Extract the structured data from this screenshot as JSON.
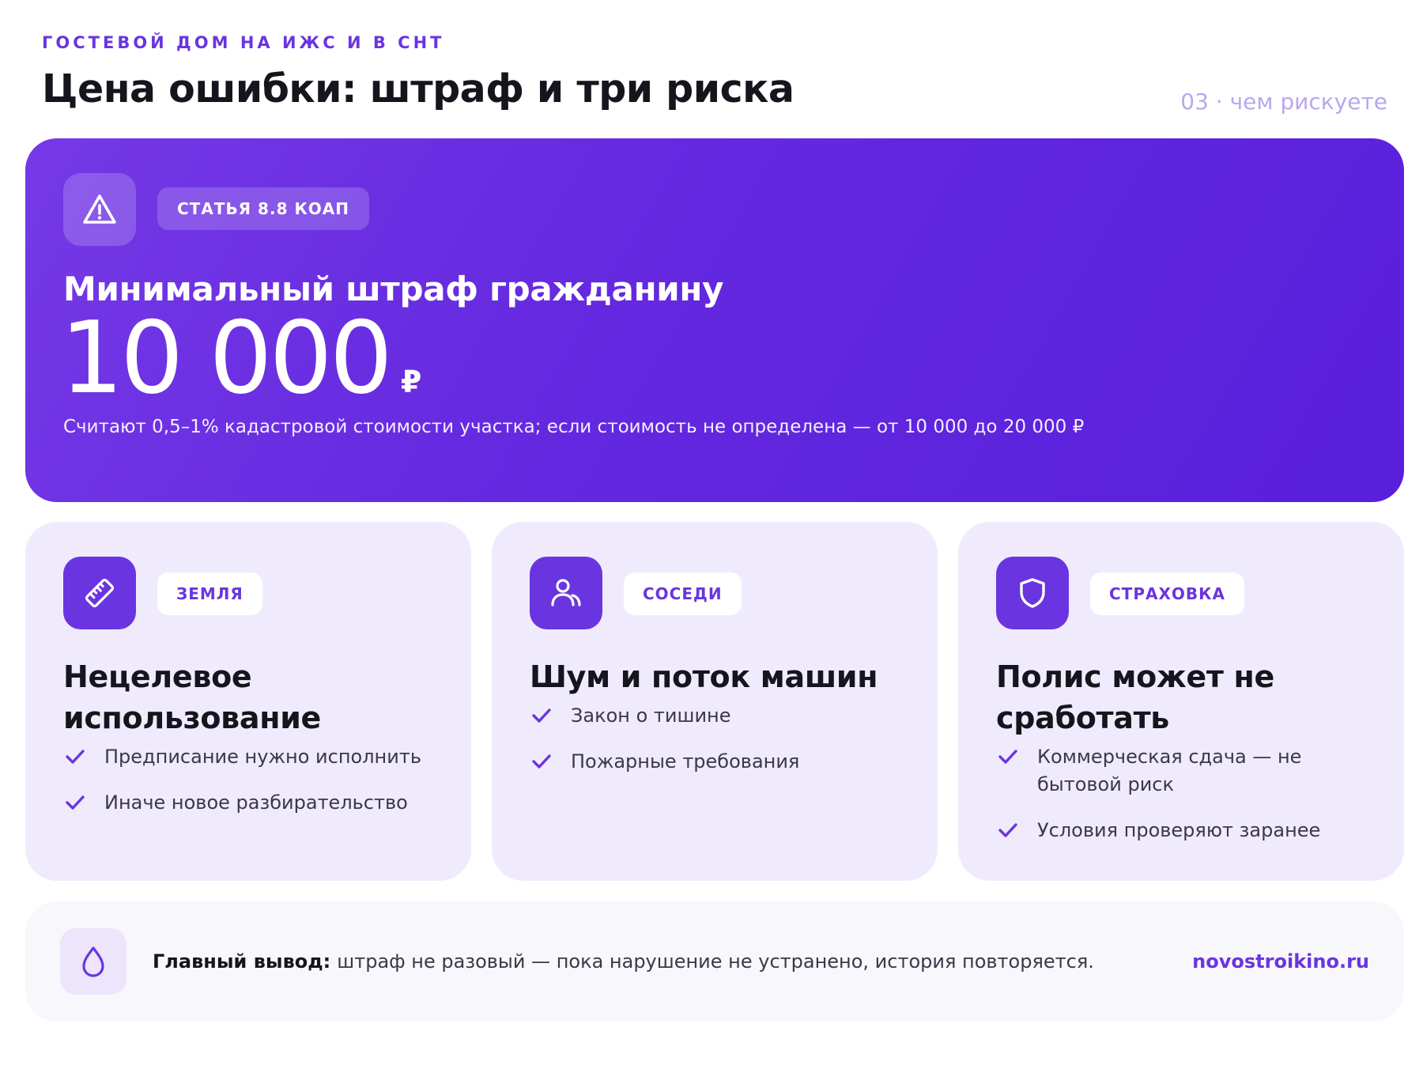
{
  "header": {
    "kicker": "ГОСТЕВОЙ ДОМ НА ИЖС И В СНТ",
    "title": "Цена ошибки: штраф и три риска",
    "counter": "03 · чем рискуете"
  },
  "hero": {
    "icon": "warning-triangle-icon",
    "badge": "СТАТЬЯ 8.8 КОАП",
    "label": "Минимальный штраф гражданину",
    "amount": "10 000",
    "currency": "₽",
    "note": "Считают 0,5–1% кадастровой стоимости участка; если стоимость не определена — от 10 000 до 20 000 ₽"
  },
  "cards": [
    {
      "icon": "ruler-icon",
      "tag": "ЗЕМЛЯ",
      "title": "Нецелевое использование",
      "items": [
        "Предписание нужно исполнить",
        "Иначе новое разбирательство"
      ]
    },
    {
      "icon": "user-icon",
      "tag": "СОСЕДИ",
      "title": "Шум и поток машин",
      "items": [
        "Закон о тишине",
        "Пожарные требования"
      ]
    },
    {
      "icon": "shield-icon",
      "tag": "СТРАХОВКА",
      "title": "Полис может не сработать",
      "items": [
        "Коммерческая сдача — не бытовой риск",
        "Условия проверяют заранее"
      ]
    }
  ],
  "footer": {
    "icon": "drop-icon",
    "lead": "Главный вывод:",
    "text": "штраф не разовый — пока нарушение не устранено, история повторяется.",
    "link": "novostroikino.ru"
  },
  "colors": {
    "accent": "#6a35e0",
    "hero_start": "#7539e6",
    "hero_end": "#5a1fdb",
    "card_bg": "#f0ebfc",
    "footer_bg": "#f8f7fb",
    "counter": "#b9a7ef"
  }
}
